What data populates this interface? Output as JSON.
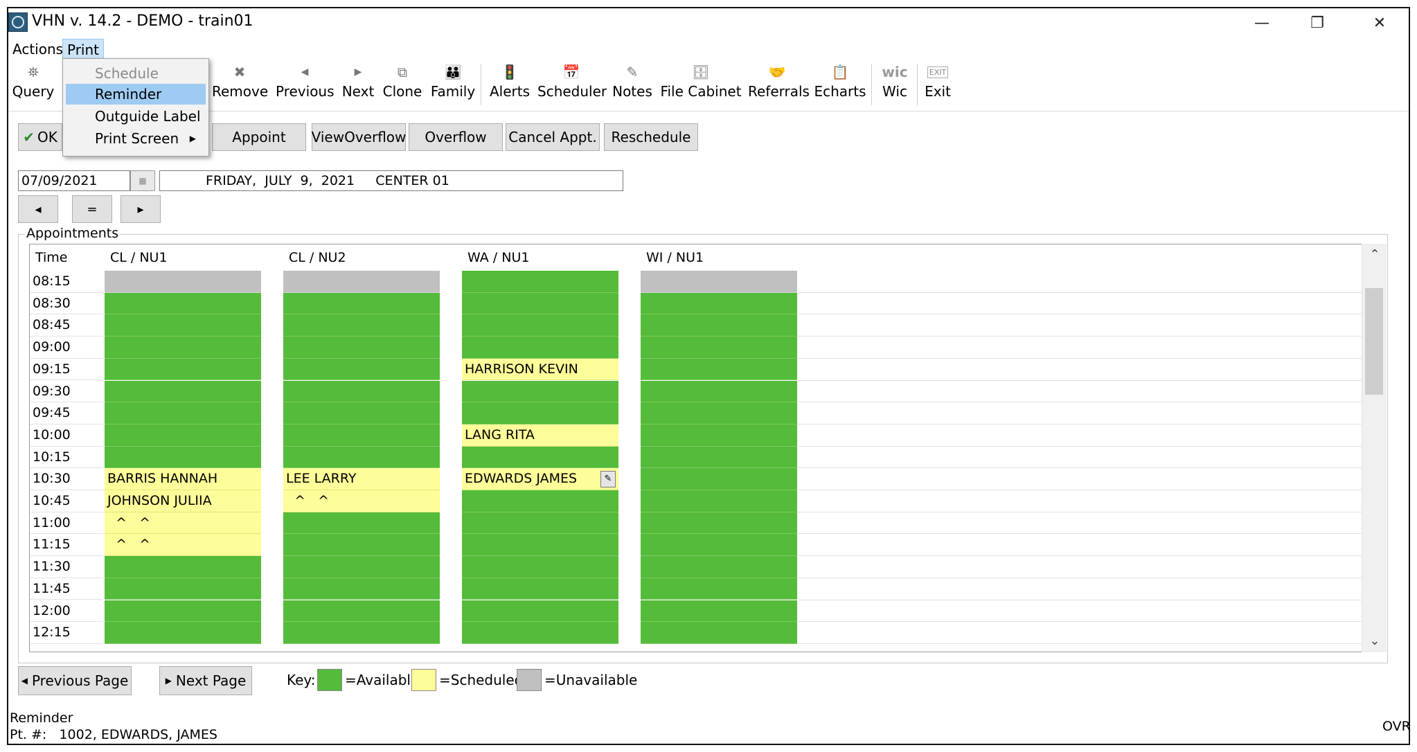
{
  "window": {
    "title": "VHN v. 14.2 - DEMO - train01",
    "minimize": "—",
    "restore": "❐",
    "close": "✕"
  },
  "menubar": {
    "actions": "Actions",
    "print": "Print"
  },
  "toolbar": {
    "query": "Query",
    "remove": "Remove",
    "previous": "Previous",
    "next": "Next",
    "clone": "Clone",
    "family": "Family",
    "alerts": "Alerts",
    "scheduler": "Scheduler",
    "notes": "Notes",
    "file_cabinet": "File Cabinet",
    "referrals": "Referrals",
    "echarts": "Echarts",
    "wic": "Wic",
    "wic_icon": "wic",
    "exit": "Exit",
    "exit_icon": "EXIT"
  },
  "print_menu": {
    "items": [
      {
        "label": "Schedule",
        "disabled": true
      },
      {
        "label": "Reminder",
        "highlighted": true
      },
      {
        "label": "Outguide Label"
      },
      {
        "label": "Print Screen",
        "submenu": true
      }
    ]
  },
  "actions_bar": {
    "ok": "OK",
    "appoint": "Appoint",
    "view_overflow": "ViewOverflow",
    "overflow": "Overflow",
    "cancel_appt": "Cancel Appt.",
    "reschedule": "Reschedule"
  },
  "date": {
    "value": "07/09/2021",
    "display": "FRIDAY,  JULY  9,  2021     CENTER 01",
    "nav_prev": "◂",
    "nav_eq": "=",
    "nav_next": "▸"
  },
  "appointments": {
    "label": "Appointments",
    "time_header": "Time",
    "columns": [
      "CL / NU1",
      "CL / NU2",
      "WA / NU1",
      "WI / NU1"
    ],
    "times": [
      "08:15",
      "08:30",
      "08:45",
      "09:00",
      "09:15",
      "09:30",
      "09:45",
      "10:00",
      "10:15",
      "10:30",
      "10:45",
      "11:00",
      "11:15",
      "11:30",
      "11:45",
      "12:00",
      "12:15"
    ],
    "slots": [
      [
        "U",
        "U",
        "A",
        "U"
      ],
      [
        "A",
        "A",
        "A",
        "A"
      ],
      [
        "A",
        "A",
        "A",
        "A"
      ],
      [
        "A",
        "A",
        "A",
        "A"
      ],
      [
        "A",
        "A",
        {
          "s": "S",
          "t": "HARRISON KEVIN"
        },
        "A"
      ],
      [
        "A",
        "A",
        "A",
        "A"
      ],
      [
        "A",
        "A",
        "A",
        "A"
      ],
      [
        "A",
        "A",
        {
          "s": "S",
          "t": "LANG RITA"
        },
        "A"
      ],
      [
        "A",
        "A",
        "A",
        "A"
      ],
      [
        {
          "s": "S",
          "t": "BARRIS HANNAH"
        },
        {
          "s": "S",
          "t": "LEE LARRY"
        },
        {
          "s": "S",
          "t": "EDWARDS JAMES",
          "edit": true
        },
        "A"
      ],
      [
        {
          "s": "S",
          "t": "JOHNSON JULIIA"
        },
        {
          "s": "S",
          "t": "  ^   ^"
        },
        "A",
        "A"
      ],
      [
        {
          "s": "S",
          "t": "  ^   ^"
        },
        "A",
        "A",
        "A"
      ],
      [
        {
          "s": "S",
          "t": "  ^   ^"
        },
        "A",
        "A",
        "A"
      ],
      [
        "A",
        "A",
        "A",
        "A"
      ],
      [
        "A",
        "A",
        "A",
        "A"
      ],
      [
        "A",
        "A",
        "A",
        "A"
      ],
      [
        "A",
        "A",
        "A",
        "A"
      ]
    ]
  },
  "pager": {
    "previous": "Previous Page",
    "next": "Next Page"
  },
  "key": {
    "label": "Key:",
    "available": "=Available",
    "scheduled": "=Scheduled",
    "unavailable": "=Unavailable"
  },
  "colors": {
    "available": "#55bb3a",
    "scheduled": "#fdfd99",
    "unavailable": "#c0c0c0",
    "menu_highlight": "#9fcbf2"
  },
  "status": {
    "line1": "Reminder",
    "line2": "Pt. #:   1002, EDWARDS, JAMES",
    "mode": "OVR"
  }
}
